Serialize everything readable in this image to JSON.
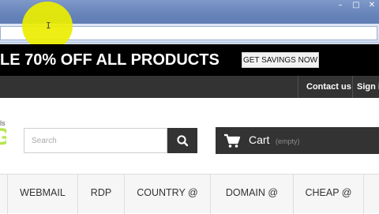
{
  "browser": {
    "window_buttons": [
      "–",
      "□",
      "✕"
    ],
    "cursor_glyph": "I"
  },
  "promo": {
    "text": "LE 70% OFF ALL PRODUCTS",
    "button_label": "GET SAVINGS NOW"
  },
  "top_nav": {
    "links": [
      "Contact us",
      "Sign i"
    ]
  },
  "header": {
    "logo_fragment_top": "ls",
    "logo_fragment_glyph": "G",
    "search": {
      "placeholder": "Search",
      "value": ""
    },
    "cart": {
      "label": "Cart",
      "status": "(empty)"
    }
  },
  "menu": {
    "items": [
      "WEBMAIL",
      "RDP",
      "COUNTRY @",
      "DOMAIN @",
      "CHEAP @"
    ]
  },
  "colors": {
    "promo_bg": "#000000",
    "nav_bg": "#333333",
    "logo_accent": "#b4e64e",
    "cursor_highlight": "#ebee00"
  },
  "icons": [
    "search-icon",
    "cart-icon",
    "minimize-icon",
    "maximize-icon",
    "close-icon"
  ]
}
